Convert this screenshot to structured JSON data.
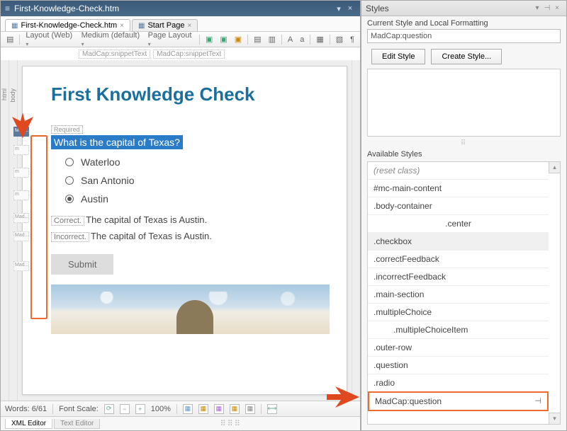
{
  "editor": {
    "title": "First-Knowledge-Check.htm",
    "tabs": [
      {
        "label": "First-Knowledge-Check.htm",
        "active": true
      },
      {
        "label": "Start Page",
        "active": false
      }
    ],
    "toolbar": {
      "layout_label": "Layout (Web)",
      "medium_label": "Medium (default)",
      "page_layout_label": "Page Layout"
    },
    "snippets": [
      "MadCap:snippetText",
      "MadCap:snippetText"
    ],
    "document": {
      "heading": "First Knowledge Check",
      "required_tag": "Required",
      "question": "What is the capital of Texas?",
      "answers": [
        {
          "label": "Waterloo",
          "selected": false
        },
        {
          "label": "San Antonio",
          "selected": false
        },
        {
          "label": "Austin",
          "selected": true
        }
      ],
      "correct_tag": "Correct.",
      "correct_text": "The capital of Texas is Austin.",
      "incorrect_tag": "Incorrect.",
      "incorrect_text": "The capital of Texas is Austin.",
      "submit_label": "Submit"
    },
    "structure_labels": [
      "MadCap:multipleChoice",
      "Mad...",
      "m",
      "m",
      "m",
      "Mad...",
      "Mad...",
      "Mad..."
    ],
    "statusbar": {
      "words": "Words: 6/61",
      "font_scale_label": "Font Scale:",
      "zoom": "100%"
    },
    "bottom_tabs": [
      "XML Editor",
      "Text Editor"
    ]
  },
  "styles": {
    "title": "Styles",
    "current_label": "Current Style and Local Formatting",
    "current_value": "MadCap:question",
    "edit_label": "Edit Style",
    "create_label": "Create Style...",
    "available_label": "Available Styles",
    "items": [
      {
        "label": "(reset class)",
        "cls": "reset"
      },
      {
        "label": "#mc-main-content",
        "cls": ""
      },
      {
        "label": ".body-container",
        "cls": ""
      },
      {
        "label": ".center",
        "cls": "center"
      },
      {
        "label": ".checkbox",
        "cls": "shaded"
      },
      {
        "label": ".correctFeedback",
        "cls": ""
      },
      {
        "label": ".incorrectFeedback",
        "cls": ""
      },
      {
        "label": ".main-section",
        "cls": ""
      },
      {
        "label": ".multipleChoice",
        "cls": ""
      },
      {
        "label": ".multipleChoiceItem",
        "cls": "indent"
      },
      {
        "label": ".outer-row",
        "cls": ""
      },
      {
        "label": ".question",
        "cls": ""
      },
      {
        "label": ".radio",
        "cls": ""
      },
      {
        "label": "MadCap:question",
        "cls": "highlight",
        "pin": true
      }
    ]
  }
}
